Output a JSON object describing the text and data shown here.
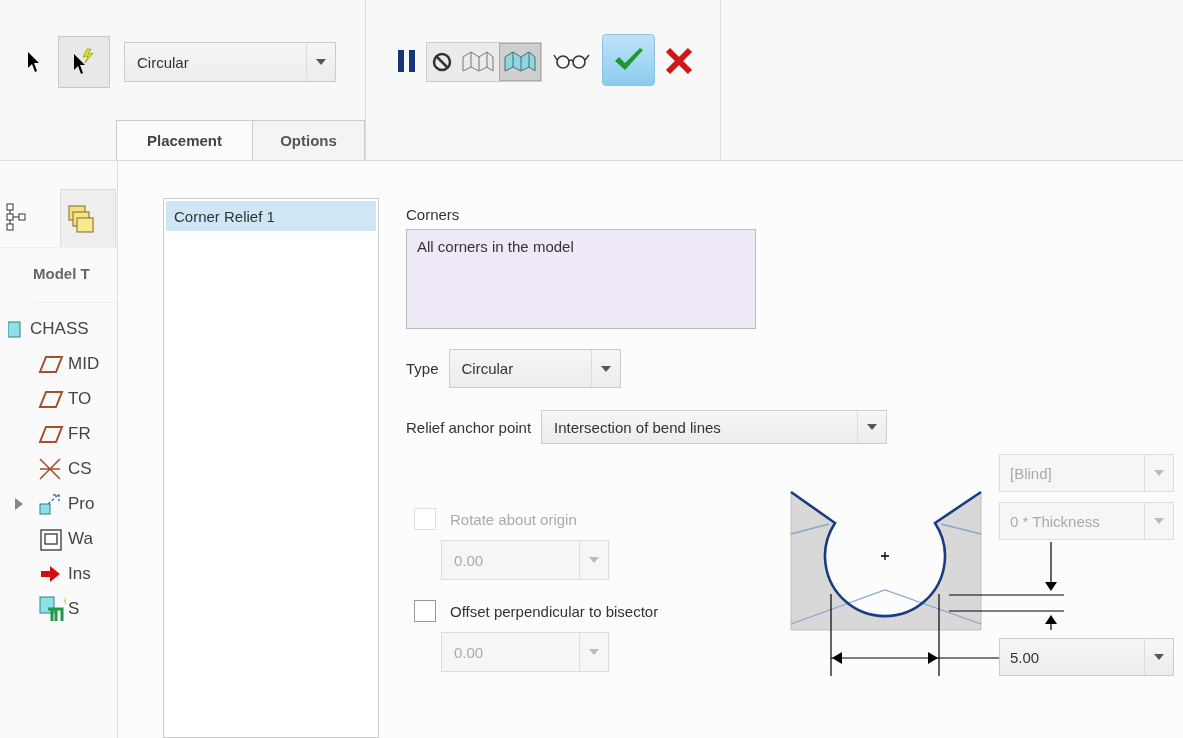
{
  "toolbar": {
    "tools": [
      {
        "kind": "arrow",
        "pressed": false
      },
      {
        "kind": "smart",
        "pressed": true
      }
    ],
    "relief_type": {
      "value": "Circular"
    },
    "pause": {
      "kind": "pause"
    },
    "display_buttons": [
      {
        "kind": "none",
        "selected": false
      },
      {
        "kind": "mesh",
        "selected": false
      },
      {
        "kind": "solid",
        "selected": true
      }
    ],
    "actions": [
      {
        "kind": "preview"
      },
      {
        "kind": "ok"
      },
      {
        "kind": "cancel"
      }
    ]
  },
  "tabs": [
    {
      "label": "Placement",
      "selected": true
    },
    {
      "label": "Options",
      "selected": false
    }
  ],
  "model_tree": {
    "tab_icons": [
      {
        "kind": "tree",
        "selected": true
      },
      {
        "kind": "layers",
        "selected": false
      }
    ],
    "heading": "Model T",
    "items": [
      {
        "label": "CHASS",
        "kind": "part",
        "expander": false,
        "children": [
          {
            "label": "MID",
            "kind": "plane",
            "expander": false
          },
          {
            "label": "TO",
            "kind": "plane",
            "expander": false
          },
          {
            "label": "FR",
            "kind": "plane",
            "expander": false
          },
          {
            "label": "CS",
            "kind": "csys",
            "expander": false
          },
          {
            "label": "Pro",
            "kind": "protrusion",
            "expander": true
          },
          {
            "label": "Wa",
            "kind": "wall",
            "expander": false
          },
          {
            "label": "Ins",
            "kind": "insert",
            "expander": false
          },
          {
            "label": "S",
            "kind": "new",
            "expander": false
          }
        ]
      }
    ]
  },
  "relief_list": {
    "items": [
      {
        "label": "Corner Relief 1",
        "selected": true
      }
    ]
  },
  "corners": {
    "label": "Corners",
    "value": "All corners in the model"
  },
  "type": {
    "label": "Type",
    "value": "Circular"
  },
  "anchor": {
    "label": "Relief anchor point",
    "value": "Intersection of bend lines"
  },
  "rotate": {
    "label": "Rotate about origin",
    "checked": false,
    "disabled": true,
    "value": "0.00",
    "value_disabled": true
  },
  "offset": {
    "label": "Offset perpendicular to bisector",
    "checked": false,
    "disabled": false,
    "value": "0.00",
    "value_disabled": true
  },
  "depth": {
    "value": "[Blind]",
    "disabled": true
  },
  "depth_size": {
    "value": "0 * Thickness",
    "disabled": true
  },
  "diameter": {
    "value": "5.00",
    "disabled": false
  }
}
